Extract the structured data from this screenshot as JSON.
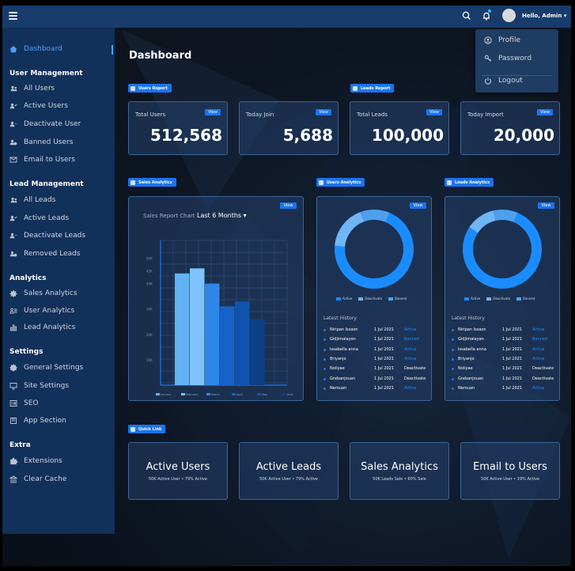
{
  "topbar": {
    "greeting": "Hello, Admin"
  },
  "sidebar": {
    "items": [
      {
        "type": "item",
        "label": "Dashboard",
        "icon": "home-icon",
        "active": true
      },
      {
        "type": "head",
        "label": "User Management"
      },
      {
        "type": "item",
        "label": "All Users",
        "icon": "users-icon"
      },
      {
        "type": "item",
        "label": "Active Users",
        "icon": "user-check-icon"
      },
      {
        "type": "item",
        "label": "Deactivate User",
        "icon": "user-minus-icon"
      },
      {
        "type": "item",
        "label": "Banned Users",
        "icon": "user-ban-icon"
      },
      {
        "type": "item",
        "label": "Email to Users",
        "icon": "email-icon"
      },
      {
        "type": "head",
        "label": "Lead Management"
      },
      {
        "type": "item",
        "label": "All Leads",
        "icon": "users-icon"
      },
      {
        "type": "item",
        "label": "Active Leads",
        "icon": "user-check-icon"
      },
      {
        "type": "item",
        "label": "Deactivate Leads",
        "icon": "user-minus-icon"
      },
      {
        "type": "item",
        "label": "Removed Leads",
        "icon": "user-ban-icon"
      },
      {
        "type": "head",
        "label": "Analytics"
      },
      {
        "type": "item",
        "label": "Sales Analytics",
        "icon": "gear-spark-icon"
      },
      {
        "type": "item",
        "label": "User Analytics",
        "icon": "user-list-icon"
      },
      {
        "type": "item",
        "label": "Lead Analytics",
        "icon": "bar-chart-icon"
      },
      {
        "type": "head",
        "label": "Settings"
      },
      {
        "type": "item",
        "label": "General Settings",
        "icon": "gear-icon"
      },
      {
        "type": "item",
        "label": "Site Settings",
        "icon": "monitor-icon"
      },
      {
        "type": "item",
        "label": "SEO",
        "icon": "seo-icon"
      },
      {
        "type": "item",
        "label": "App Section",
        "icon": "app-icon"
      },
      {
        "type": "head",
        "label": "Extra"
      },
      {
        "type": "item",
        "label": "Extensions",
        "icon": "puzzle-icon"
      },
      {
        "type": "item",
        "label": "Clear Cache",
        "icon": "bank-icon"
      }
    ]
  },
  "dropdown": {
    "profile": "Profile",
    "password": "Password",
    "logout": "Logout"
  },
  "main": {
    "title": "Dashboard",
    "tags": {
      "users_report": "Users Report",
      "leads_report": "Leads Report",
      "sales_analytics": "Sales Analytics",
      "users_analytics": "Users Analytics",
      "leads_analytics": "Leads Analytics",
      "quick_link": "Quick Link"
    },
    "view_label": "View",
    "stats": [
      {
        "label": "Total Users",
        "value": "512,568"
      },
      {
        "label": "Today Join",
        "value": "5,688"
      },
      {
        "label": "Total Leads",
        "value": "100,000"
      },
      {
        "label": "Today Import",
        "value": "20,000"
      }
    ],
    "sales_chart": {
      "heading": "Sales Report Chart",
      "range": "Last 6 Months"
    },
    "latest_history": "Latest History",
    "users_history": [
      {
        "name": "Niripan Issaon",
        "date": "1 Jul 2021",
        "status": "Active",
        "color": "#1a8cff"
      },
      {
        "name": "Gidjimalayan",
        "date": "1 Jul 2021",
        "status": "Banned",
        "color": "#1a8cff"
      },
      {
        "name": "Issabella anna",
        "date": "1 Jul 2021",
        "status": "Active",
        "color": "#1a8cff"
      },
      {
        "name": "Briyanjo",
        "date": "1 Jul 2021",
        "status": "Active",
        "color": "#1a8cff"
      },
      {
        "name": "Noliyae",
        "date": "1 Jul 2021",
        "status": "Deactivate",
        "color": "#ffffff"
      },
      {
        "name": "Grebanjouan",
        "date": "1 Jul 2021",
        "status": "Deactivate",
        "color": "#ffffff"
      },
      {
        "name": "Nerouan",
        "date": "1 Jul 2021",
        "status": "Active",
        "color": "#1a8cff"
      }
    ],
    "leads_history": [
      {
        "name": "Niripan Issaon",
        "date": "1 Jul 2021",
        "status": "Active",
        "color": "#1a8cff"
      },
      {
        "name": "Gidjimalayan",
        "date": "1 Jul 2021",
        "status": "Banned",
        "color": "#1a8cff"
      },
      {
        "name": "Issabella anna",
        "date": "1 Jul 2021",
        "status": "Active",
        "color": "#1a8cff"
      },
      {
        "name": "Briyanjo",
        "date": "1 Jul 2021",
        "status": "Active",
        "color": "#1a8cff"
      },
      {
        "name": "Noliyae",
        "date": "1 Jul 2021",
        "status": "Deactivate",
        "color": "#ffffff"
      },
      {
        "name": "Grebanjouan",
        "date": "1 Jul 2021",
        "status": "Deactivate",
        "color": "#ffffff"
      },
      {
        "name": "Nerouan",
        "date": "1 Jul 2021",
        "status": "Active",
        "color": "#1a8cff"
      }
    ],
    "quick_links": [
      {
        "title": "Active Users",
        "sub": "50K Active User • 79% Active"
      },
      {
        "title": "Active Leads",
        "sub": "50K Active User • 79% Active"
      },
      {
        "title": "Sales Analytics",
        "sub": "50K Leads Sale • 60% Sale"
      },
      {
        "title": "Email to Users",
        "sub": "50K Active User • 19% Active"
      }
    ]
  },
  "chart_data": [
    {
      "type": "bar",
      "categories": [
        "January",
        "February",
        "March",
        "April",
        "May",
        "June"
      ],
      "values": [
        44,
        46,
        40,
        31,
        33,
        26
      ],
      "ytick_labels": [
        "50K",
        "45K",
        "40K",
        "30K",
        "20K",
        "10K"
      ],
      "yticks": [
        50,
        45,
        40,
        30,
        20,
        10
      ],
      "ylim": [
        0,
        57
      ],
      "colors": [
        "#62b1f5",
        "#7cc3ff",
        "#2f86e6",
        "#1563c6",
        "#0e54ad",
        "#0c3f85"
      ],
      "legend": [
        "January",
        "February",
        "March",
        "April",
        "May",
        "June"
      ],
      "title": "",
      "xlabel": "",
      "ylabel": ""
    },
    {
      "type": "pie",
      "name": "Users Analytics",
      "labels": [
        "Active",
        "Deactivate",
        "Banned"
      ],
      "values": [
        70,
        18,
        12
      ],
      "colors": [
        "#1a8cff",
        "#6fb6f5",
        "#4da0ee"
      ]
    },
    {
      "type": "pie",
      "name": "Leads Analytics",
      "labels": [
        "Active",
        "Deactivate",
        "Banned"
      ],
      "values": [
        78,
        12,
        10
      ],
      "colors": [
        "#1a8cff",
        "#6fb6f5",
        "#4da0ee"
      ]
    }
  ]
}
